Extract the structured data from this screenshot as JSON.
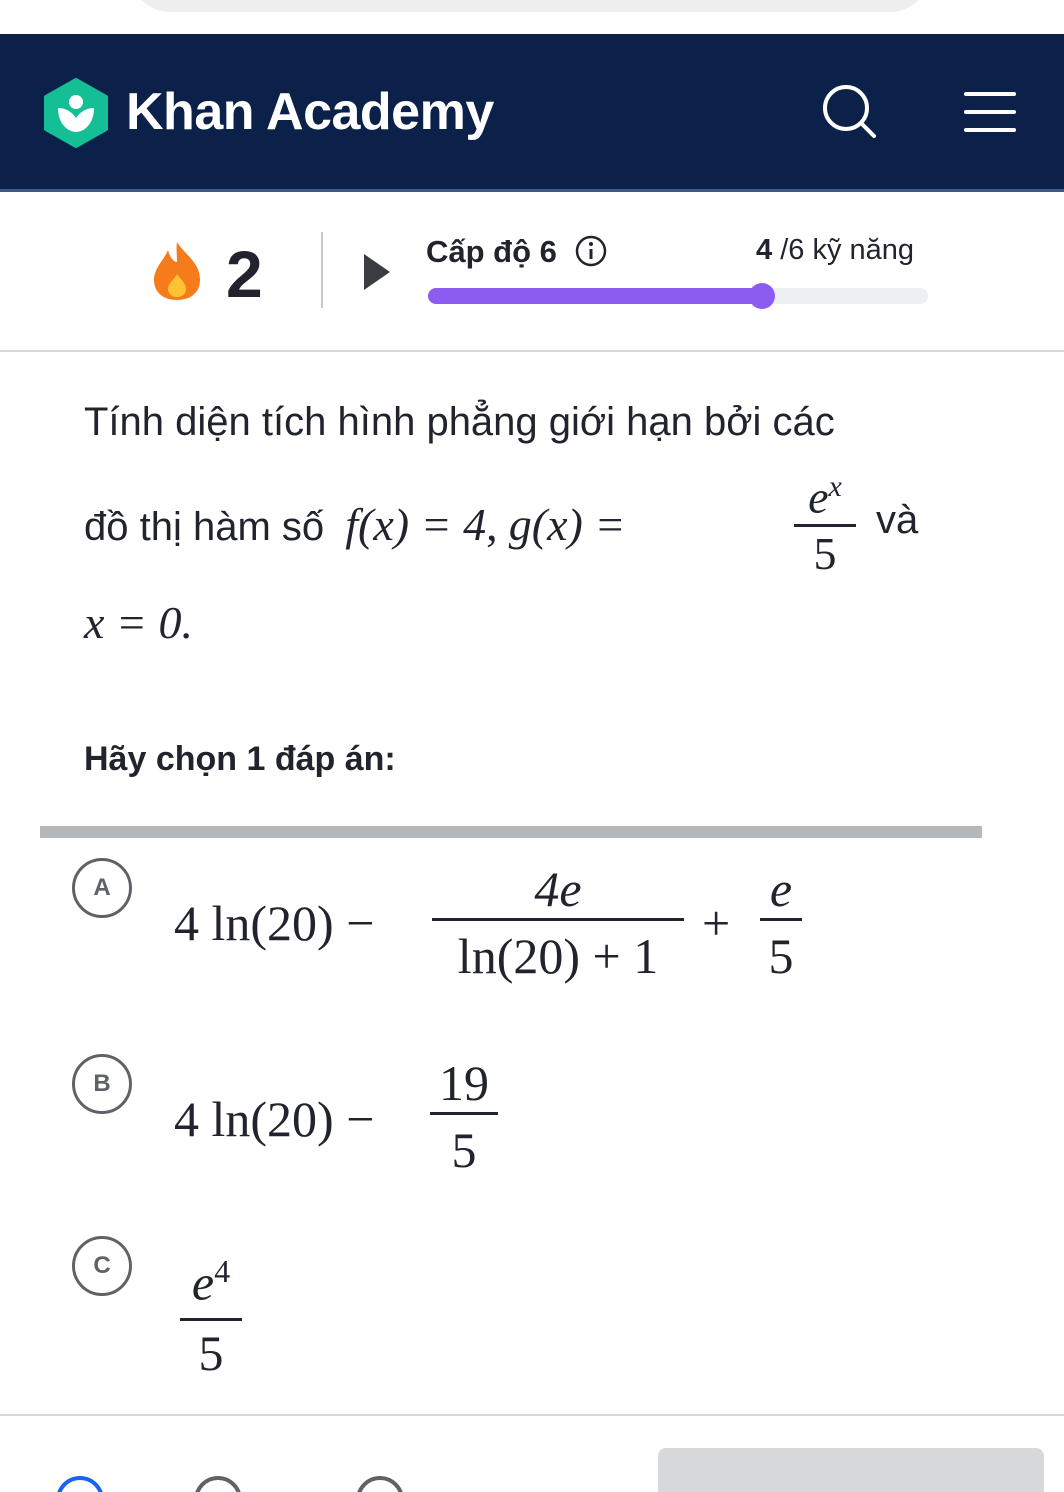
{
  "header": {
    "brand": "Khan Academy",
    "colors": {
      "background": "#0b2149",
      "logo": "#14bf96"
    },
    "icons": [
      "khan-logo-icon",
      "search-icon",
      "hamburger-menu-icon"
    ]
  },
  "status": {
    "streak_count": "2",
    "level_label": "Cấp độ 6",
    "skills_done": "4",
    "skills_rest": " /6 kỹ năng",
    "progress_fraction": 0.667,
    "colors": {
      "progress": "#8c5cf0",
      "flame": "#f57b1b"
    }
  },
  "question": {
    "line1": "Tính diện tích hình phẳng giới hạn bởi các",
    "line2_prefix": "đồ thị hàm số",
    "f_expr": "f(x) = 4",
    "sep": ",",
    "g_expr": "g(x) =",
    "g_num": "e",
    "g_num_sup": "x",
    "g_den": "5",
    "va": "và",
    "line3": "x = 0."
  },
  "prompt": "Hãy chọn 1 đáp án:",
  "choices": [
    {
      "letter": "A",
      "lead": "4 ln(20) −",
      "frac1_num": "4e",
      "frac1_den": "ln(20) + 1",
      "plus": "+",
      "frac2_num": "e",
      "frac2_den": "5"
    },
    {
      "letter": "B",
      "lead": "4 ln(20) −",
      "frac_num": "19",
      "frac_den": "5"
    },
    {
      "letter": "C",
      "frac_num": "e",
      "frac_num_sup": "4",
      "frac_den": "5"
    }
  ]
}
